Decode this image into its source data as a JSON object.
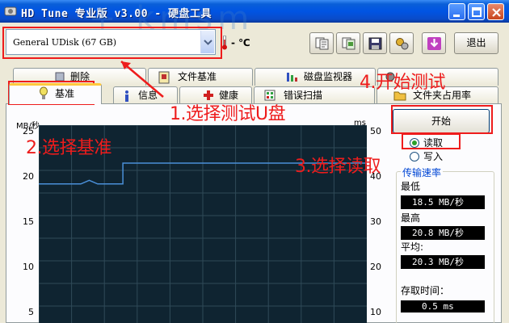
{
  "window": {
    "title": "HD Tune 专业版 v3.00 - 硬盘工具"
  },
  "watermark": "+ kmsm",
  "toolbar": {
    "drive": "General UDisk (67 GB)",
    "temperature": "- ℃",
    "exit_label": "退出"
  },
  "tabs_top": [
    {
      "label": "删除",
      "icon": "delete-icon"
    },
    {
      "label": "文件基准",
      "icon": "file-benchmark-icon"
    },
    {
      "label": "磁盘监视器",
      "icon": "disk-monitor-icon"
    },
    {
      "label": "",
      "icon": "aam-icon"
    }
  ],
  "tabs_bottom": [
    {
      "label": "基准",
      "icon": "benchmark-icon",
      "active": true
    },
    {
      "label": "信息",
      "icon": "info-icon"
    },
    {
      "label": "健康",
      "icon": "health-icon"
    },
    {
      "label": "错误扫描",
      "icon": "error-scan-icon"
    },
    {
      "label": "文件夹占用率",
      "icon": "folder-usage-icon"
    }
  ],
  "chart_data": {
    "type": "line",
    "ylabel_left": "MB/秒",
    "ylabel_right": "ms",
    "yticks_left": [
      "25",
      "20",
      "15",
      "10",
      "5"
    ],
    "yticks_right": [
      "50",
      "40",
      "30",
      "20",
      "10"
    ],
    "ylim_left": [
      0,
      25
    ],
    "ylim_right": [
      0,
      50
    ],
    "grid": true,
    "series": [
      {
        "values": [
          18.5,
          18.5,
          18.5,
          18.5,
          18.5,
          18.5,
          18.9,
          18.5,
          18.5,
          18.5,
          20.8,
          20.8,
          20.8,
          20.8,
          20.8,
          20.8,
          20.8,
          20.8,
          20.8,
          20.8,
          20.8,
          20.8,
          20.8,
          20.8,
          20.8,
          20.8,
          20.8,
          20.8,
          20.8,
          20.8,
          20.8,
          20.8,
          20.8,
          20.8,
          20.8,
          20.8,
          20.8,
          20.8,
          20.8,
          20.8
        ]
      }
    ]
  },
  "controls": {
    "start_label": "开始",
    "read_label": "读取",
    "write_label": "写入",
    "read_selected": true
  },
  "transfer": {
    "group_title": "传输速率",
    "min_label": "最低",
    "min_value": "18.5 MB/秒",
    "max_label": "最高",
    "max_value": "20.8 MB/秒",
    "avg_label": "平均:",
    "avg_value": "20.3 MB/秒",
    "access_label": "存取时间：",
    "access_value": "0.5 ms"
  },
  "annotations": {
    "step1": "1.选择测试U盘",
    "step2": "2.选择基准",
    "step3": "3.选择读取",
    "step4": "4.开始测试"
  }
}
